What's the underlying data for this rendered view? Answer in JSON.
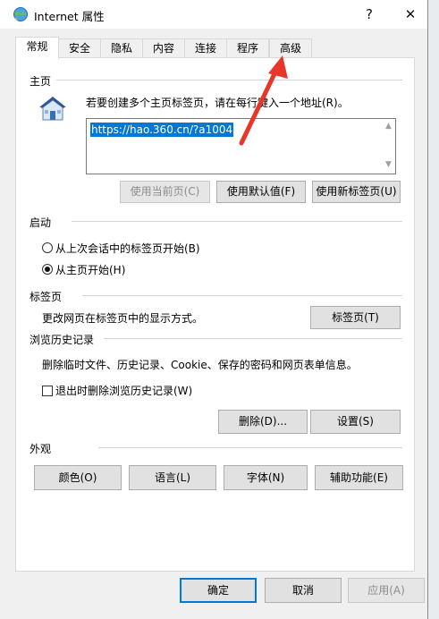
{
  "window": {
    "title": "Internet 属性",
    "help_label": "?",
    "close_label": "✕"
  },
  "tabs": [
    {
      "label": "常规",
      "active": true
    },
    {
      "label": "安全"
    },
    {
      "label": "隐私"
    },
    {
      "label": "内容"
    },
    {
      "label": "连接"
    },
    {
      "label": "程序"
    },
    {
      "label": "高级"
    }
  ],
  "home": {
    "group_label": "主页",
    "instruction": "若要创建多个主页标签页，请在每行键入一个地址(R)。",
    "url_value": "https://hao.360.cn/?a1004",
    "buttons": {
      "use_current": "使用当前页(C)",
      "use_default": "使用默认值(F)",
      "use_new_tab": "使用新标签页(U)"
    }
  },
  "startup": {
    "group_label": "启动",
    "options": [
      {
        "label": "从上次会话中的标签页开始(B)",
        "checked": false
      },
      {
        "label": "从主页开始(H)",
        "checked": true
      }
    ]
  },
  "tabs_section": {
    "group_label": "标签页",
    "description": "更改网页在标签页中的显示方式。",
    "button": "标签页(T)"
  },
  "history": {
    "group_label": "浏览历史记录",
    "description": "删除临时文件、历史记录、Cookie、保存的密码和网页表单信息。",
    "checkbox_label": "退出时删除浏览历史记录(W)",
    "checkbox_checked": false,
    "delete_button": "删除(D)...",
    "settings_button": "设置(S)"
  },
  "appearance": {
    "group_label": "外观",
    "buttons": {
      "colors": "颜色(O)",
      "languages": "语言(L)",
      "fonts": "字体(N)",
      "accessibility": "辅助功能(E)"
    }
  },
  "footer": {
    "ok": "确定",
    "cancel": "取消",
    "apply": "应用(A)"
  },
  "colors": {
    "accent": "#0078d7",
    "annotation_arrow": "#e8362b"
  }
}
